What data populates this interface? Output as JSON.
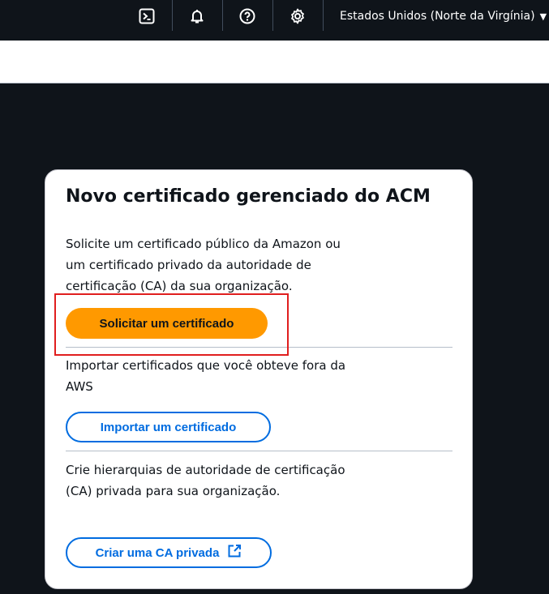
{
  "topbar": {
    "icons": {
      "cloudshell": "cloudshell-icon",
      "notifications": "bell-icon",
      "support": "help-icon",
      "settings": "gear-icon"
    },
    "region_label": "Estados Unidos (Norte da Virgínia)",
    "region_caret": "▼"
  },
  "card": {
    "title": "Novo certificado gerenciado do ACM",
    "section1": {
      "description": "Solicite um certificado público da Amazon ou um certificado privado da autoridade de certificação (CA) da sua organização.",
      "button_label": "Solicitar um certificado"
    },
    "section2": {
      "description": "Importar certificados que você obteve fora da AWS",
      "button_label": "Importar um certificado"
    },
    "section3": {
      "description": "Crie hierarquias de autoridade de certificação (CA) privada para sua organização.",
      "button_label": "Criar uma CA privada",
      "button_icon": "external-link-icon"
    }
  },
  "colors": {
    "primary_button": "#ff9900",
    "link": "#006ce0",
    "highlight": "#e01e1e",
    "background": "#0f141a"
  }
}
